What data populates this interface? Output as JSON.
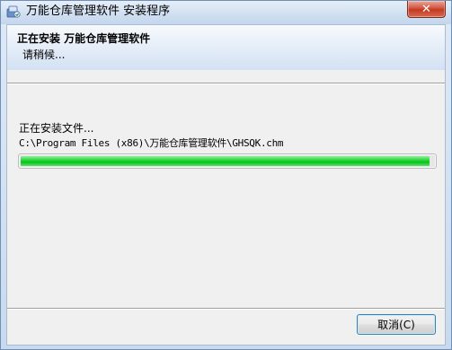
{
  "window": {
    "title": "万能仓库管理软件 安装程序",
    "close_glyph": "✕"
  },
  "header": {
    "title": "正在安装 万能仓库管理软件",
    "subtitle": "请稍候..."
  },
  "status": {
    "text": "正在安装文件...",
    "file_path": "C:\\Program Files (x86)\\万能仓库管理软件\\GHSQK.chm"
  },
  "progress": {
    "percent": 99
  },
  "buttons": {
    "cancel_label": "取消(C)"
  },
  "icons": {
    "app": "installer-app-icon",
    "close": "close-icon"
  },
  "colors": {
    "progress_green": "#07c21c",
    "close_red": "#c23a23"
  }
}
